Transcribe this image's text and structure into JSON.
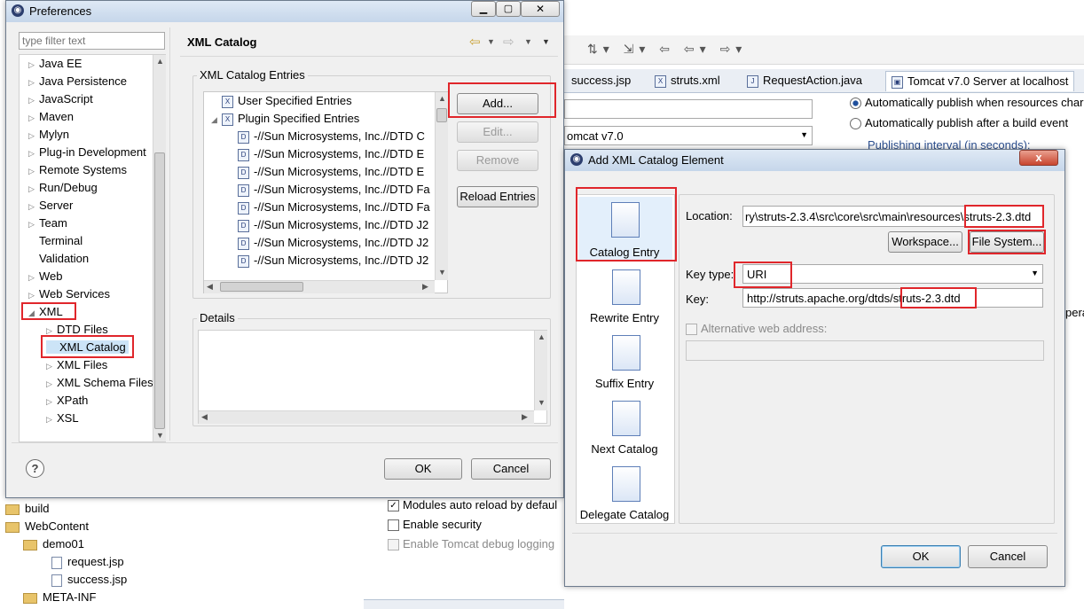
{
  "background": {
    "tabs": [
      "success.jsp",
      "struts.xml",
      "RequestAction.java",
      "Tomcat v7.0 Server at localhost"
    ],
    "server_dropdown": "omcat v7.0",
    "publish_options": [
      "Automatically publish when resources char",
      "Automatically publish after a build event"
    ],
    "publishing_interval_label": "Publishing interval (in seconds):",
    "right_edge_text": "pera",
    "checkboxes": [
      "Modules auto reload by defaul",
      "Enable security",
      "Enable Tomcat debug logging"
    ],
    "project_tree": [
      {
        "label": "build",
        "indent": 0
      },
      {
        "label": "WebContent",
        "indent": 0
      },
      {
        "label": "demo01",
        "indent": 1
      },
      {
        "label": "request.jsp",
        "indent": 2
      },
      {
        "label": "success.jsp",
        "indent": 2
      },
      {
        "label": "META-INF",
        "indent": 1
      }
    ]
  },
  "preferences": {
    "title": "Preferences",
    "filter_placeholder": "type filter text",
    "page_title": "XML Catalog",
    "tree": [
      {
        "label": "Java EE",
        "indent": 0,
        "expanded": false
      },
      {
        "label": "Java Persistence",
        "indent": 0,
        "expanded": false
      },
      {
        "label": "JavaScript",
        "indent": 0,
        "expanded": false
      },
      {
        "label": "Maven",
        "indent": 0,
        "expanded": false
      },
      {
        "label": "Mylyn",
        "indent": 0,
        "expanded": false
      },
      {
        "label": "Plug-in Development",
        "indent": 0,
        "expanded": false
      },
      {
        "label": "Remote Systems",
        "indent": 0,
        "expanded": false
      },
      {
        "label": "Run/Debug",
        "indent": 0,
        "expanded": false
      },
      {
        "label": "Server",
        "indent": 0,
        "expanded": false
      },
      {
        "label": "Team",
        "indent": 0,
        "expanded": false
      },
      {
        "label": "Terminal",
        "indent": 0,
        "leaf": true
      },
      {
        "label": "Validation",
        "indent": 0,
        "leaf": true
      },
      {
        "label": "Web",
        "indent": 0,
        "expanded": false
      },
      {
        "label": "Web Services",
        "indent": 0,
        "expanded": false
      },
      {
        "label": "XML",
        "indent": 0,
        "expanded": true
      },
      {
        "label": "DTD Files",
        "indent": 1,
        "expanded": false
      },
      {
        "label": "XML Catalog",
        "indent": 1,
        "leaf": true
      },
      {
        "label": "XML Files",
        "indent": 1,
        "expanded": false
      },
      {
        "label": "XML Schema Files",
        "indent": 1,
        "expanded": false
      },
      {
        "label": "XPath",
        "indent": 1,
        "expanded": false
      },
      {
        "label": "XSL",
        "indent": 1,
        "expanded": false
      }
    ],
    "entries_group_label": "XML Catalog Entries",
    "entries": [
      {
        "label": "User Specified Entries",
        "type": "folder",
        "indent": 0
      },
      {
        "label": "Plugin Specified Entries",
        "type": "folder",
        "indent": 0
      },
      {
        "label": "-//Sun Microsystems, Inc.//DTD C",
        "type": "dtd",
        "indent": 1
      },
      {
        "label": "-//Sun Microsystems, Inc.//DTD E",
        "type": "dtd",
        "indent": 1
      },
      {
        "label": "-//Sun Microsystems, Inc.//DTD E",
        "type": "dtd",
        "indent": 1
      },
      {
        "label": "-//Sun Microsystems, Inc.//DTD Fa",
        "type": "dtd",
        "indent": 1
      },
      {
        "label": "-//Sun Microsystems, Inc.//DTD Fa",
        "type": "dtd",
        "indent": 1
      },
      {
        "label": "-//Sun Microsystems, Inc.//DTD J2",
        "type": "dtd",
        "indent": 1
      },
      {
        "label": "-//Sun Microsystems, Inc.//DTD J2",
        "type": "dtd",
        "indent": 1
      },
      {
        "label": "-//Sun Microsystems, Inc.//DTD J2",
        "type": "dtd",
        "indent": 1
      }
    ],
    "buttons": {
      "add": "Add...",
      "edit": "Edit...",
      "remove": "Remove",
      "reload": "Reload Entries"
    },
    "details_label": "Details",
    "ok": "OK",
    "cancel": "Cancel",
    "help_glyph": "?"
  },
  "dialog": {
    "title": "Add XML Catalog Element",
    "side_items": [
      "Catalog Entry",
      "Rewrite Entry",
      "Suffix Entry",
      "Next Catalog",
      "Delegate Catalog"
    ],
    "location_label": "Location:",
    "location_value": "ry\\struts-2.3.4\\src\\core\\src\\main\\resources\\struts-2.3.dtd",
    "workspace_btn": "Workspace...",
    "filesystem_btn": "File System...",
    "key_type_label": "Key type:",
    "key_type_value": "URI",
    "key_label": "Key:",
    "key_value": "http://struts.apache.org/dtds/struts-2.3.dtd",
    "alt_label": "Alternative web address:",
    "ok": "OK",
    "cancel": "Cancel",
    "close_glyph": "x"
  },
  "colors": {
    "highlight": "#e0262b",
    "selection": "#cce4f7",
    "titlebar": "#c5d6ea"
  }
}
